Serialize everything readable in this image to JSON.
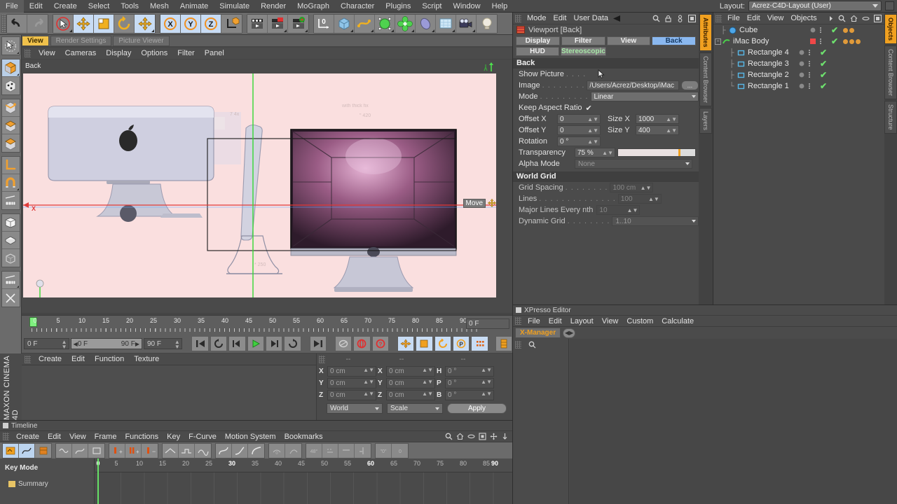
{
  "app": {
    "title": "CINEMA 4D",
    "logo_text": "MAXON CINEMA 4D"
  },
  "menubar": {
    "items": [
      "File",
      "Edit",
      "Create",
      "Select",
      "Tools",
      "Mesh",
      "Animate",
      "Simulate",
      "Render",
      "MoGraph",
      "Character",
      "Plugins",
      "Script",
      "Window",
      "Help"
    ],
    "layout_label": "Layout:",
    "layout_value": "Acrez-C4D-Layout (User)"
  },
  "toolbar": {
    "groups": [
      {
        "name": "undo-redo",
        "buttons": [
          {
            "icon": "undo-icon",
            "selected": false
          },
          {
            "icon": "redo-icon",
            "selected": false
          }
        ]
      },
      {
        "name": "modes",
        "buttons": [
          {
            "icon": "select-live-icon",
            "selected": false
          },
          {
            "icon": "move-icon",
            "selected": true
          },
          {
            "icon": "scale-icon",
            "selected": false
          },
          {
            "icon": "rotate-icon",
            "selected": false
          },
          {
            "icon": "move-plus-icon",
            "selected": true
          }
        ]
      },
      {
        "name": "axis-locks",
        "buttons": [
          {
            "icon": "axis-x-icon",
            "selected": true
          },
          {
            "icon": "axis-y-icon",
            "selected": true
          },
          {
            "icon": "axis-z-icon",
            "selected": true
          },
          {
            "icon": "world-object-axis-icon",
            "selected": false
          }
        ]
      },
      {
        "name": "render",
        "buttons": [
          {
            "icon": "render-view-icon",
            "selected": false
          },
          {
            "icon": "render-region-icon",
            "selected": false
          },
          {
            "icon": "render-settings-icon",
            "selected": false
          }
        ]
      },
      {
        "name": "objects",
        "buttons": [
          {
            "icon": "null-object-icon",
            "selected": false
          },
          {
            "icon": "cube-primitive-icon",
            "selected": false
          },
          {
            "icon": "spline-icon",
            "selected": false
          },
          {
            "icon": "generator-icon",
            "selected": false
          },
          {
            "icon": "deformer-icon",
            "selected": false
          },
          {
            "icon": "environment-icon",
            "selected": false
          },
          {
            "icon": "scene-icon",
            "selected": false
          },
          {
            "icon": "camera-icon",
            "selected": false
          },
          {
            "icon": "light-icon",
            "selected": false
          }
        ]
      }
    ]
  },
  "left_toolbar": {
    "groups": [
      {
        "buttons": [
          {
            "icon": "live-selection-icon",
            "selected": false
          }
        ]
      },
      {
        "buttons": [
          {
            "icon": "cube-orange-icon",
            "selected": true
          },
          {
            "icon": "points-mode-icon",
            "selected": false
          }
        ]
      },
      {
        "buttons": [
          {
            "icon": "edges-mode-icon",
            "selected": false
          },
          {
            "icon": "polygons-mode-icon",
            "selected": false
          },
          {
            "icon": "model-mode-icon",
            "selected": false
          }
        ]
      },
      {
        "buttons": [
          {
            "icon": "axis-mode-icon",
            "selected": false
          },
          {
            "icon": "magnet-icon",
            "selected": false
          },
          {
            "icon": "workplane-icon",
            "selected": false
          }
        ]
      },
      {
        "buttons": [
          {
            "icon": "box-solid-icon",
            "selected": false
          },
          {
            "icon": "box-flat-icon",
            "selected": false
          },
          {
            "icon": "box-wire-icon",
            "selected": false
          }
        ]
      },
      {
        "buttons": [
          {
            "icon": "ruler-icon",
            "selected": false
          },
          {
            "icon": "snap-icon",
            "selected": false
          }
        ]
      }
    ]
  },
  "viewport": {
    "tabs": [
      {
        "label": "View",
        "active": true
      },
      {
        "label": "Render Settings",
        "active": false
      },
      {
        "label": "Picture Viewer",
        "active": false
      }
    ],
    "menu": [
      "View",
      "Cameras",
      "Display",
      "Options",
      "Filter",
      "Panel"
    ],
    "label": "Back",
    "axis_x_label": "X",
    "axis_y_label": "Y",
    "tooltip": "Move",
    "background_color": "#fadfdf"
  },
  "timeline_slider": {
    "ticks": [
      0,
      5,
      10,
      15,
      20,
      25,
      30,
      35,
      40,
      45,
      50,
      55,
      60,
      65,
      70,
      75,
      80,
      85,
      90
    ],
    "current_frame_field": "0 F",
    "start_field": "0 F",
    "range_start": "0 F",
    "range_end": "90 F",
    "end_field": "90 F",
    "playhead_frame": 0,
    "buttons": [
      {
        "icon": "goto-start-icon"
      },
      {
        "icon": "loop-prev-icon"
      },
      {
        "icon": "step-back-icon"
      },
      {
        "icon": "play-icon"
      },
      {
        "icon": "step-forward-icon"
      },
      {
        "icon": "loop-next-icon"
      },
      {
        "icon": "goto-end-icon"
      },
      {
        "icon": "autokey-mode-icon"
      },
      {
        "icon": "record-active-icon"
      },
      {
        "icon": "autokeying-icon"
      },
      {
        "icon": "key-position-icon"
      },
      {
        "icon": "key-scale-icon"
      },
      {
        "icon": "key-rotation-icon"
      },
      {
        "icon": "key-param-icon"
      },
      {
        "icon": "key-pla-icon"
      },
      {
        "icon": "keyframe-selection-icon"
      }
    ]
  },
  "material_manager": {
    "menu": [
      "Create",
      "Edit",
      "Function",
      "Texture"
    ]
  },
  "coordinates": {
    "headers": [
      "--",
      "--",
      "--"
    ],
    "rows": [
      {
        "axis1": "X",
        "v1": "0 cm",
        "axis2": "X",
        "v2": "0 cm",
        "axis3": "H",
        "v3": "0 °"
      },
      {
        "axis1": "Y",
        "v1": "0 cm",
        "axis2": "Y",
        "v2": "0 cm",
        "axis3": "P",
        "v3": "0 °"
      },
      {
        "axis1": "Z",
        "v1": "0 cm",
        "axis2": "Z",
        "v2": "0 cm",
        "axis3": "B",
        "v3": "0 °"
      }
    ],
    "system": "World",
    "mode": "Scale",
    "apply_label": "Apply"
  },
  "timeline_window": {
    "title": "Timeline",
    "menu": [
      "Create",
      "Edit",
      "View",
      "Frame",
      "Functions",
      "Key",
      "F-Curve",
      "Motion System",
      "Bookmarks"
    ],
    "tool_groups": [
      {
        "buttons": [
          {
            "icon": "key-mode-icon",
            "selected": true
          },
          {
            "icon": "fcurve-mode-icon",
            "selected": true
          },
          {
            "icon": "motion-mode-icon",
            "selected": false
          }
        ]
      },
      {
        "buttons": [
          {
            "icon": "show-animated-icon",
            "selected": false
          },
          {
            "icon": "show-fcurve-icon",
            "selected": false
          },
          {
            "icon": "show-all-icon",
            "selected": false
          }
        ]
      },
      {
        "buttons": [
          {
            "icon": "add-key-icon",
            "selected": false
          },
          {
            "icon": "move-key-icon",
            "selected": false
          },
          {
            "icon": "delete-key-icon",
            "selected": false
          }
        ]
      },
      {
        "buttons": [
          {
            "icon": "linear-interp-icon",
            "selected": false
          },
          {
            "icon": "step-interp-icon",
            "selected": false
          },
          {
            "icon": "spline-interp-icon",
            "selected": false
          }
        ]
      },
      {
        "buttons": [
          {
            "icon": "ease-in-icon",
            "selected": false
          },
          {
            "icon": "ease-out-icon",
            "selected": false
          },
          {
            "icon": "ease-both-icon",
            "selected": false
          }
        ]
      },
      {
        "buttons": [
          {
            "icon": "zero-angle-icon",
            "selected": false
          },
          {
            "icon": "soft-tangent-icon",
            "selected": false
          }
        ]
      },
      {
        "buttons": [
          {
            "icon": "snap-key-icon",
            "selected": false
          },
          {
            "icon": "lock-tangent-icon",
            "selected": false
          },
          {
            "icon": "flat-tangent-icon",
            "selected": false
          },
          {
            "icon": "break-tangent-icon",
            "selected": false
          }
        ]
      },
      {
        "buttons": [
          {
            "icon": "zero-value-icon",
            "selected": false
          },
          {
            "icon": "reset-value-icon",
            "selected": false
          }
        ]
      }
    ],
    "key_mode_label": "Key Mode",
    "summary_label": "Summary",
    "ruler_ticks": [
      0,
      5,
      10,
      15,
      20,
      25,
      30,
      35,
      40,
      45,
      50,
      55,
      60,
      65,
      70,
      75,
      80,
      85,
      90
    ],
    "major_ticks": [
      0,
      30,
      60,
      90
    ],
    "playhead_frame": 0,
    "toolbar_right_icons": [
      "search-icon",
      "home-icon",
      "link-icon",
      "layout-icon",
      "move-panel-icon",
      "down-arrow-icon"
    ]
  },
  "attributes": {
    "panel_menu": [
      "Mode",
      "Edit",
      "User Data"
    ],
    "header_icons": [
      "back-arrow-icon",
      "search-icon",
      "lock-icon",
      "pin-icon",
      "expand-icon"
    ],
    "object_title": "Viewport [Back]",
    "tabs_row1": [
      {
        "label": "Display",
        "selected": false
      },
      {
        "label": "Filter",
        "selected": false
      },
      {
        "label": "View",
        "selected": false
      },
      {
        "label": "Back",
        "selected": true
      }
    ],
    "tabs_row2": [
      {
        "label": "HUD",
        "selected": false
      },
      {
        "label": "Stereoscopic",
        "selected": false,
        "green": true
      }
    ],
    "section_back": "Back",
    "fields": {
      "show_picture_label": "Show Picture",
      "show_picture_value": "",
      "image_label": "Image",
      "image_value": "/Users/Acrez/Desktop/iMac",
      "image_browse": "...",
      "mode_label": "Mode",
      "mode_value": "Linear",
      "keep_aspect_label": "Keep Aspect Ratio",
      "keep_aspect_checked": "✔",
      "offset_x_label": "Offset X",
      "offset_x_value": "0",
      "size_x_label": "Size X",
      "size_x_value": "1000",
      "offset_y_label": "Offset Y",
      "offset_y_value": "0",
      "size_y_label": "Size Y",
      "size_y_value": "400",
      "rotation_label": "Rotation",
      "rotation_value": "0 °",
      "transparency_label": "Transparency",
      "transparency_value": "75 %",
      "transparency_pct": 75,
      "alpha_mode_label": "Alpha Mode",
      "alpha_mode_value": "None"
    },
    "section_world_grid": "World Grid",
    "world_grid": {
      "grid_spacing_label": "Grid Spacing",
      "grid_spacing_value": "100 cm",
      "lines_label": "Lines",
      "lines_value": "100",
      "major_lines_label": "Major Lines Every nth",
      "major_lines_value": "10",
      "dynamic_grid_label": "Dynamic Grid",
      "dynamic_grid_value": "1..10"
    },
    "side_tabs": [
      {
        "label": "Attributes",
        "selected": true
      },
      {
        "label": "Content Browser",
        "selected": false
      },
      {
        "label": "Layers",
        "selected": false
      }
    ]
  },
  "object_manager": {
    "menu": [
      "File",
      "Edit",
      "View",
      "Objects"
    ],
    "header_icons": [
      "more-arrow-icon",
      "search-icon",
      "home-icon",
      "link-icon",
      "expand-icon"
    ],
    "items": [
      {
        "name": "Cube",
        "icon": "cube-object-icon",
        "indent": 0,
        "dot_color": "#8a8a8a",
        "visible": "✔",
        "tags": 2,
        "expandable": false
      },
      {
        "name": "iMac Body",
        "icon": "spline-object-icon",
        "indent": 0,
        "dot_color": "#f04040",
        "visible": "✔",
        "tags": 3,
        "expandable": true
      },
      {
        "name": "Rectangle 4",
        "icon": "rect-spline-icon",
        "indent": 1,
        "dot_color": "#8a8a8a",
        "visible": "✔",
        "tags": 0,
        "expandable": false
      },
      {
        "name": "Rectangle 3",
        "icon": "rect-spline-icon",
        "indent": 1,
        "dot_color": "#8a8a8a",
        "visible": "✔",
        "tags": 0,
        "expandable": false
      },
      {
        "name": "Rectangle 2",
        "icon": "rect-spline-icon",
        "indent": 1,
        "dot_color": "#8a8a8a",
        "visible": "✔",
        "tags": 0,
        "expandable": false
      },
      {
        "name": "Rectangle 1",
        "icon": "rect-spline-icon",
        "indent": 1,
        "dot_color": "#8a8a8a",
        "visible": "✔",
        "tags": 0,
        "expandable": false
      }
    ],
    "side_tabs": [
      {
        "label": "Objects",
        "selected": true
      },
      {
        "label": "Content Browser",
        "selected": false
      },
      {
        "label": "Structure",
        "selected": false
      }
    ]
  },
  "xpresso": {
    "title": "XPresso Editor",
    "menu": [
      "File",
      "Edit",
      "Layout",
      "View",
      "Custom",
      "Calculate"
    ],
    "tab_label": "X-Manager",
    "nav_icon": "prev-next-icon",
    "search_icon": "search-icon"
  },
  "colors": {
    "accent_blue": "#8ab8f0",
    "accent_orange": "#f0a020",
    "panel_bg": "#4b4b4b",
    "toolbar_bg": "#6b6b6b",
    "viewport_bg": "#fadfdf",
    "green_check": "#6ee06e"
  }
}
